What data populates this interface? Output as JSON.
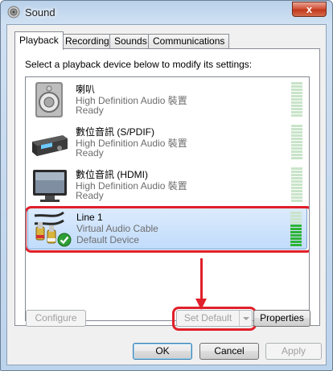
{
  "window": {
    "title": "Sound",
    "icon": "speaker-icon",
    "close_label": "x"
  },
  "tabs": [
    {
      "label": "Playback",
      "active": true
    },
    {
      "label": "Recording",
      "active": false
    },
    {
      "label": "Sounds",
      "active": false
    },
    {
      "label": "Communications",
      "active": false
    }
  ],
  "panel": {
    "instruction": "Select a playback device below to modify its settings:"
  },
  "devices": [
    {
      "name": "喇叭",
      "driver": "High Definition Audio 裝置",
      "state": "Ready",
      "icon": "speaker-icon",
      "level": 0
    },
    {
      "name": "數位音訊 (S/PDIF)",
      "driver": "High Definition Audio 裝置",
      "state": "Ready",
      "icon": "spdif-receiver-icon",
      "level": 0
    },
    {
      "name": "數位音訊 (HDMI)",
      "driver": "High Definition Audio 裝置",
      "state": "Ready",
      "icon": "monitor-icon",
      "level": 0
    },
    {
      "name": "Line 1",
      "driver": "Virtual Audio Cable",
      "state": "Default Device",
      "icon": "rca-cable-icon",
      "badge": "default-check-icon",
      "selected": true,
      "level": 0.6
    }
  ],
  "buttons": {
    "configure": "Configure",
    "set_default": "Set Default",
    "properties": "Properties",
    "ok": "OK",
    "cancel": "Cancel",
    "apply": "Apply"
  },
  "colors": {
    "annotation": "#e0202a",
    "selection": "#c1dcfc",
    "meter_active": "#2fb437"
  }
}
